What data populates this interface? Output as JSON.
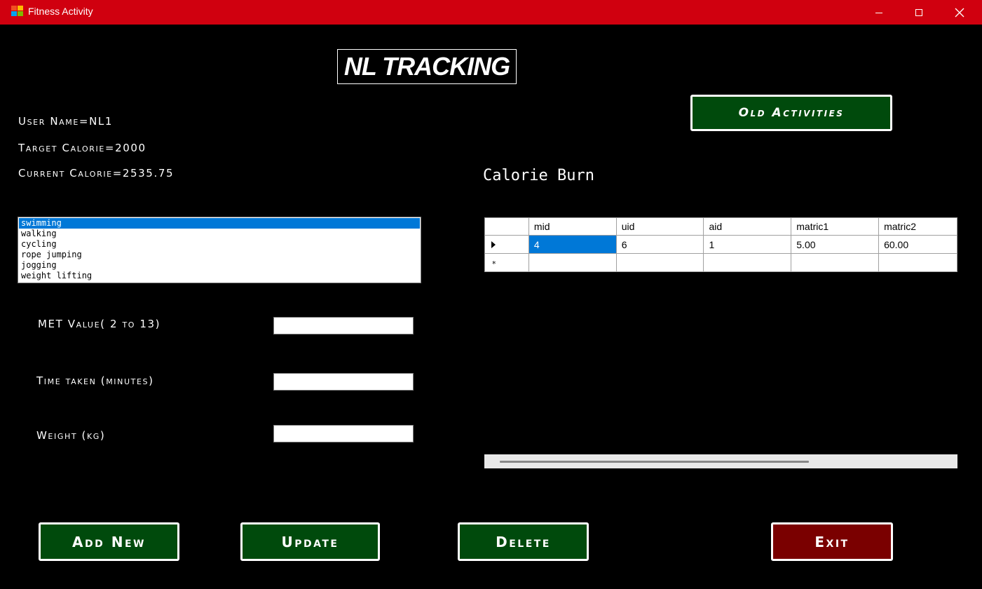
{
  "window": {
    "title": "Fitness Activity"
  },
  "header": {
    "logo_text": "NL TRACKING"
  },
  "user": {
    "name_text": "User Name=NL1",
    "target_text": "Target Calorie=2000",
    "current_text": "Current Calorie=2535.75"
  },
  "activities": {
    "items": [
      "swimming",
      "walking",
      "cycling",
      "rope jumping",
      "jogging",
      "weight lifting"
    ],
    "selected": "swimming"
  },
  "form": {
    "met_label": "MET Value( 2 to 13)",
    "time_label": "Time taken (minutes)",
    "weight_label": "Weight (kg)",
    "met_value": "",
    "time_value": "",
    "weight_value": ""
  },
  "calorie": {
    "heading": "Calorie Burn",
    "columns": [
      "mid",
      "uid",
      "aid",
      "matric1",
      "matric2"
    ],
    "rows": [
      [
        "4",
        "6",
        "1",
        "5.00",
        "60.00"
      ]
    ]
  },
  "buttons": {
    "old_activities": "Old Activities",
    "add_new": "Add New",
    "update": "Update",
    "delete": "Delete",
    "exit": "Exit"
  },
  "colors": {
    "titlebar": "#d0000f",
    "button_green": "#004a0c",
    "button_red": "#7a0000",
    "selection": "#0078d7"
  }
}
